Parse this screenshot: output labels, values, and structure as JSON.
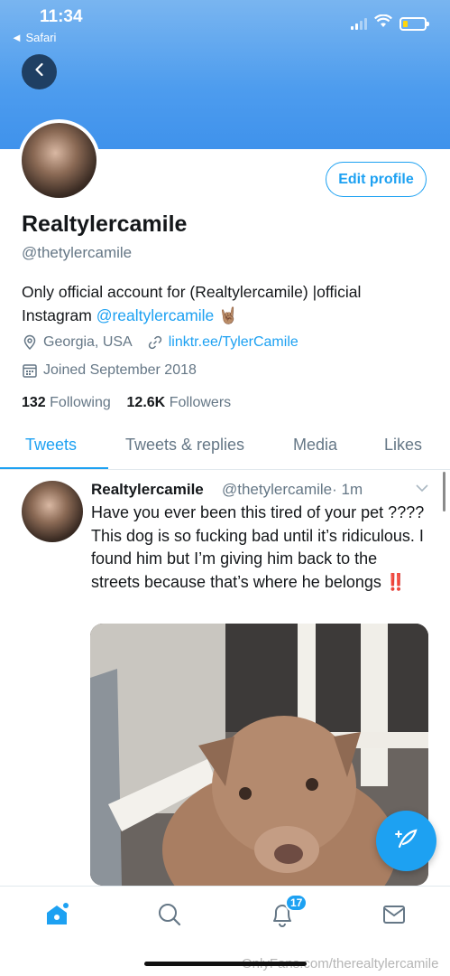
{
  "status_bar": {
    "time": "11:34",
    "back_app": "◄ Safari"
  },
  "profile": {
    "display_name": "Realtylercamile",
    "handle": "@thetylercamile",
    "bio_text": "Only official account for (Realtylercamile) |official Instagram ",
    "bio_link": "@realtylercamile",
    "bio_emoji": "🤘🏽",
    "location": "Georgia, USA",
    "website": "linktr.ee/TylerCamile",
    "joined": "Joined September 2018",
    "following_count": "132",
    "following_label": "Following",
    "followers_count": "12.6K",
    "followers_label": "Followers",
    "edit_button": "Edit profile"
  },
  "tabs": [
    {
      "label": "Tweets",
      "active": true
    },
    {
      "label": "Tweets & replies",
      "active": false
    },
    {
      "label": "Media",
      "active": false
    },
    {
      "label": "Likes",
      "active": false
    }
  ],
  "tweet": {
    "name": "Realtylercamile",
    "handle": "@thetylercamile",
    "time": "· 1m",
    "text": "Have you ever been this tired of your pet ???? This dog is so fucking bad until it’s ridiculous. I found him but I’m giving him back to the streets because that’s where he belongs ",
    "emphasis": "‼️"
  },
  "bottom_nav": {
    "notifications_badge": "17"
  },
  "watermark": "OnlyFans.com/therealtylercamile",
  "icons": [
    "back-arrow-icon",
    "location-pin-icon",
    "link-icon",
    "calendar-icon",
    "chevron-down-icon",
    "compose-icon",
    "home-icon",
    "search-icon",
    "bell-icon",
    "mail-icon"
  ],
  "colors": {
    "accent": "#1da1f2",
    "banner": "#4d9cee",
    "text": "#14171a",
    "muted": "#657786"
  }
}
